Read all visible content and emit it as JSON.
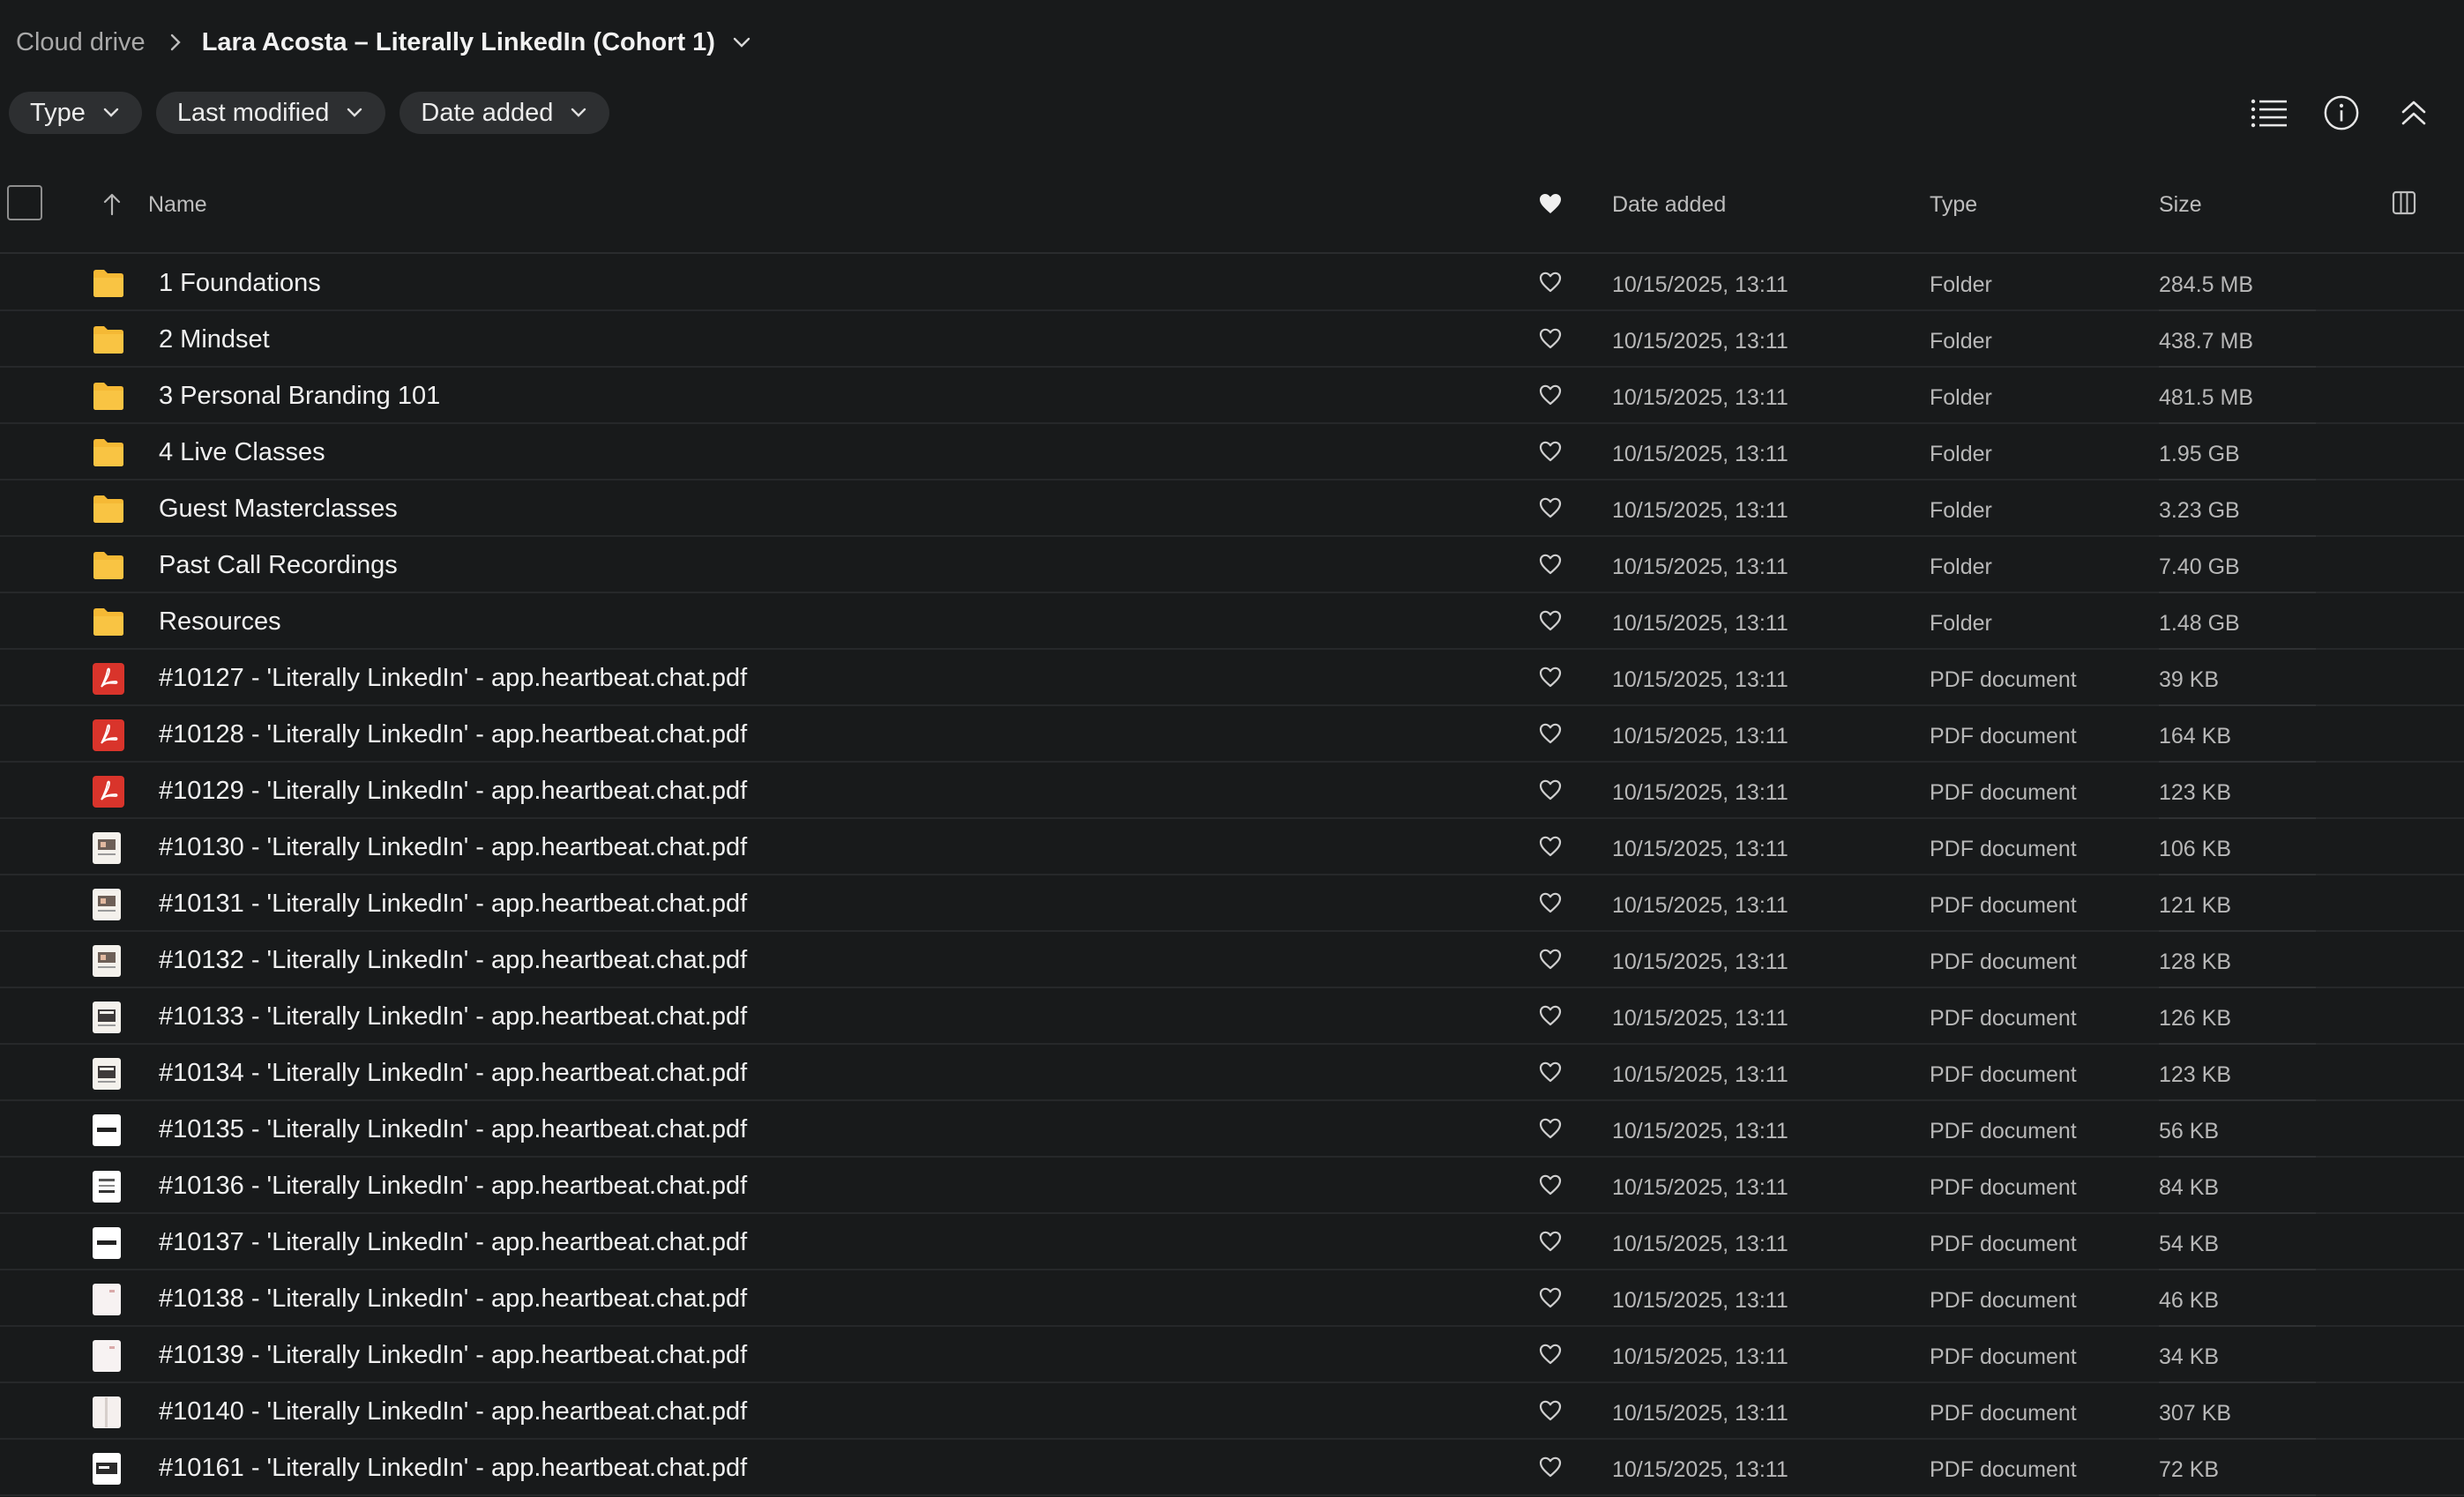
{
  "breadcrumb": {
    "root": "Cloud drive",
    "current": "Lara Acosta – Literally LinkedIn (Cohort 1)"
  },
  "filters": [
    {
      "label": "Type"
    },
    {
      "label": "Last modified"
    },
    {
      "label": "Date added"
    }
  ],
  "columns": {
    "name": "Name",
    "date_added": "Date added",
    "type": "Type",
    "size": "Size"
  },
  "rows": [
    {
      "name": "1 Foundations",
      "date": "10/15/2025, 13:11",
      "type": "Folder",
      "size": "284.5 MB",
      "icon": "folder-icon"
    },
    {
      "name": "2 Mindset",
      "date": "10/15/2025, 13:11",
      "type": "Folder",
      "size": "438.7 MB",
      "icon": "folder-icon"
    },
    {
      "name": "3 Personal Branding 101",
      "date": "10/15/2025, 13:11",
      "type": "Folder",
      "size": "481.5 MB",
      "icon": "folder-icon"
    },
    {
      "name": "4 Live Classes",
      "date": "10/15/2025, 13:11",
      "type": "Folder",
      "size": "1.95 GB",
      "icon": "folder-icon"
    },
    {
      "name": "Guest Masterclasses",
      "date": "10/15/2025, 13:11",
      "type": "Folder",
      "size": "3.23 GB",
      "icon": "folder-icon"
    },
    {
      "name": "Past Call Recordings",
      "date": "10/15/2025, 13:11",
      "type": "Folder",
      "size": "7.40 GB",
      "icon": "folder-icon"
    },
    {
      "name": "Resources",
      "date": "10/15/2025, 13:11",
      "type": "Folder",
      "size": "1.48 GB",
      "icon": "folder-icon"
    },
    {
      "name": "#10127 - 'Literally LinkedIn' - app.heartbeat.chat.pdf",
      "date": "10/15/2025, 13:11",
      "type": "PDF document",
      "size": "39 KB",
      "icon": "pdf-icon"
    },
    {
      "name": "#10128 - 'Literally LinkedIn' - app.heartbeat.chat.pdf",
      "date": "10/15/2025, 13:11",
      "type": "PDF document",
      "size": "164 KB",
      "icon": "pdf-icon"
    },
    {
      "name": "#10129 - 'Literally LinkedIn' - app.heartbeat.chat.pdf",
      "date": "10/15/2025, 13:11",
      "type": "PDF document",
      "size": "123 KB",
      "icon": "pdf-icon"
    },
    {
      "name": "#10130 - 'Literally LinkedIn' - app.heartbeat.chat.pdf",
      "date": "10/15/2025, 13:11",
      "type": "PDF document",
      "size": "106 KB",
      "icon": "pdf-thumbnail-icon"
    },
    {
      "name": "#10131 - 'Literally LinkedIn' - app.heartbeat.chat.pdf",
      "date": "10/15/2025, 13:11",
      "type": "PDF document",
      "size": "121 KB",
      "icon": "pdf-thumbnail-icon"
    },
    {
      "name": "#10132 - 'Literally LinkedIn' - app.heartbeat.chat.pdf",
      "date": "10/15/2025, 13:11",
      "type": "PDF document",
      "size": "128 KB",
      "icon": "pdf-thumbnail-icon"
    },
    {
      "name": "#10133 - 'Literally LinkedIn' - app.heartbeat.chat.pdf",
      "date": "10/15/2025, 13:11",
      "type": "PDF document",
      "size": "126 KB",
      "icon": "pdf-thumbnail-icon"
    },
    {
      "name": "#10134 - 'Literally LinkedIn' - app.heartbeat.chat.pdf",
      "date": "10/15/2025, 13:11",
      "type": "PDF document",
      "size": "123 KB",
      "icon": "pdf-thumbnail-icon"
    },
    {
      "name": "#10135 - 'Literally LinkedIn' - app.heartbeat.chat.pdf",
      "date": "10/15/2025, 13:11",
      "type": "PDF document",
      "size": "56 KB",
      "icon": "pdf-thumbnail-icon"
    },
    {
      "name": "#10136 - 'Literally LinkedIn' - app.heartbeat.chat.pdf",
      "date": "10/15/2025, 13:11",
      "type": "PDF document",
      "size": "84 KB",
      "icon": "pdf-thumbnail-icon"
    },
    {
      "name": "#10137 - 'Literally LinkedIn' - app.heartbeat.chat.pdf",
      "date": "10/15/2025, 13:11",
      "type": "PDF document",
      "size": "54 KB",
      "icon": "pdf-thumbnail-icon"
    },
    {
      "name": "#10138 - 'Literally LinkedIn' - app.heartbeat.chat.pdf",
      "date": "10/15/2025, 13:11",
      "type": "PDF document",
      "size": "46 KB",
      "icon": "pdf-thumbnail-icon"
    },
    {
      "name": "#10139 - 'Literally LinkedIn' - app.heartbeat.chat.pdf",
      "date": "10/15/2025, 13:11",
      "type": "PDF document",
      "size": "34 KB",
      "icon": "pdf-thumbnail-icon"
    },
    {
      "name": "#10140 - 'Literally LinkedIn' - app.heartbeat.chat.pdf",
      "date": "10/15/2025, 13:11",
      "type": "PDF document",
      "size": "307 KB",
      "icon": "pdf-thumbnail-icon"
    },
    {
      "name": "#10161 - 'Literally LinkedIn' - app.heartbeat.chat.pdf",
      "date": "10/15/2025, 13:11",
      "type": "PDF document",
      "size": "72 KB",
      "icon": "pdf-thumbnail-icon"
    }
  ],
  "colors": {
    "background": "#181a1b",
    "folder": "#f5b935",
    "pdf": "#d9342b",
    "chip": "#2d2f31"
  }
}
